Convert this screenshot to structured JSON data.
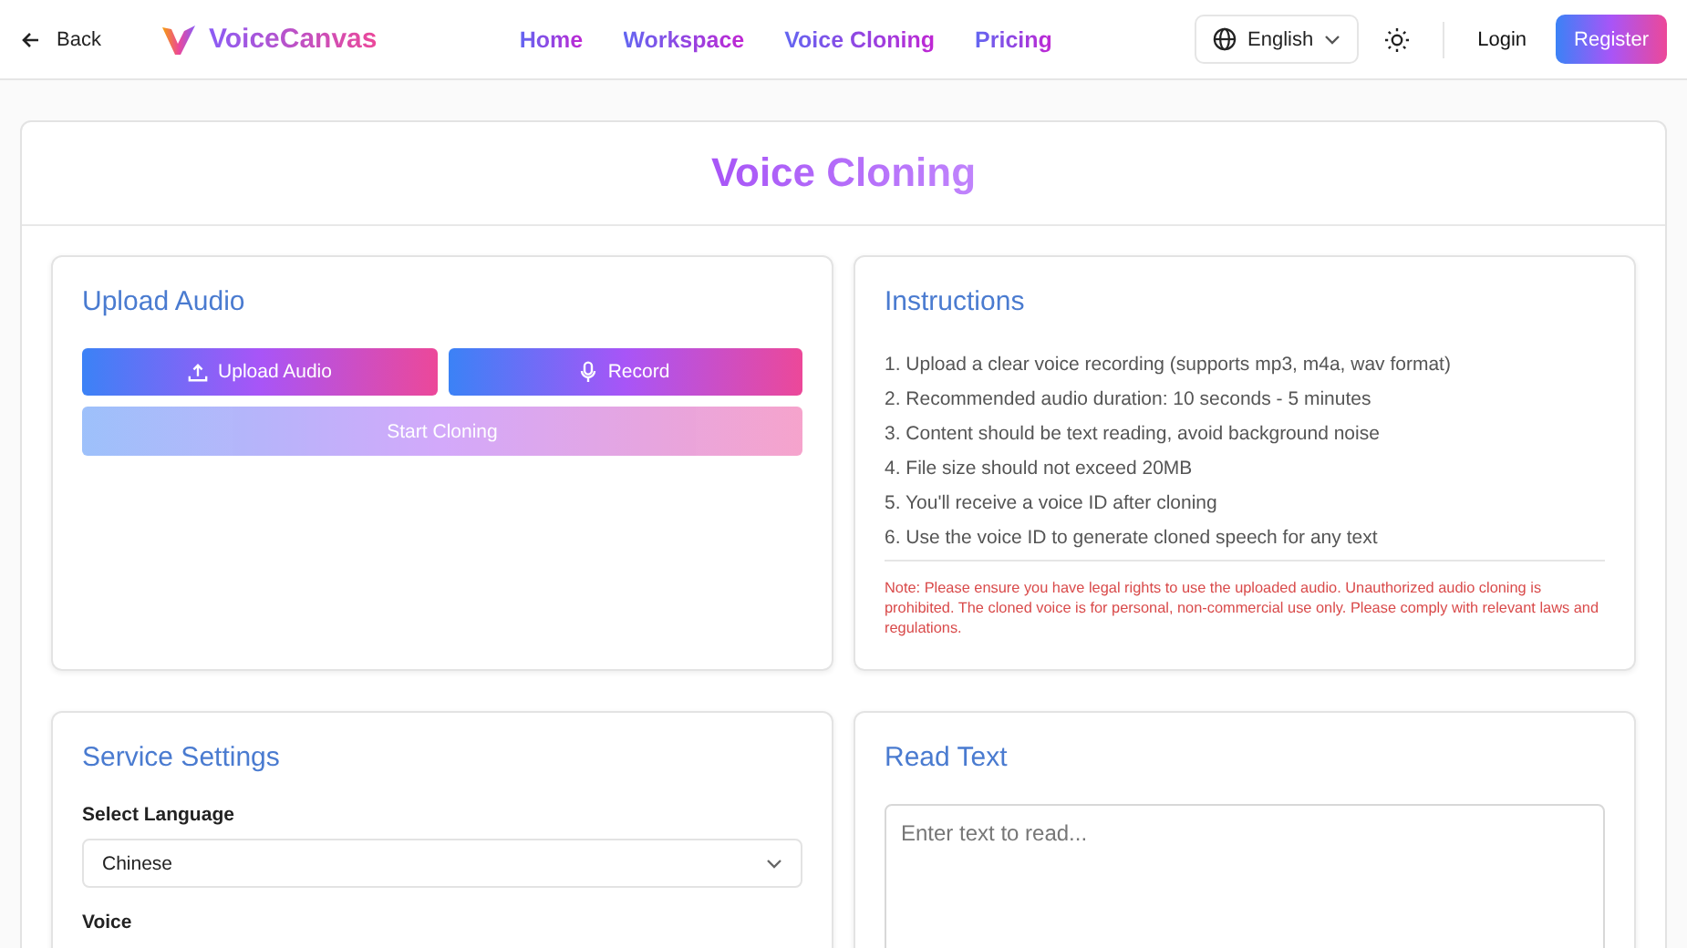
{
  "header": {
    "back": "Back",
    "brand": "VoiceCanvas",
    "nav": [
      "Home",
      "Workspace",
      "Voice Cloning",
      "Pricing"
    ],
    "language": "English",
    "login": "Login",
    "register": "Register"
  },
  "page_title": "Voice Cloning",
  "upload": {
    "title": "Upload Audio",
    "buttons": [
      {
        "kind": "upload",
        "label": "Upload Audio",
        "disabled": false
      },
      {
        "kind": "record",
        "label": "Record",
        "disabled": false
      }
    ],
    "start": {
      "label": "Start Cloning",
      "disabled": true
    }
  },
  "instructions": {
    "title": "Instructions",
    "items": [
      "1. Upload a clear voice recording (supports mp3, m4a, wav format)",
      "2. Recommended audio duration: 10 seconds - 5 minutes",
      "3. Content should be text reading, avoid background noise",
      "4. File size should not exceed 20MB",
      "5. You'll receive a voice ID after cloning",
      "6. Use the voice ID to generate cloned speech for any text"
    ],
    "note": "Note: Please ensure you have legal rights to use the uploaded audio. Unauthorized audio cloning is prohibited. The cloned voice is for personal, non-commercial use only. Please comply with relevant laws and regulations."
  },
  "settings": {
    "title": "Service Settings",
    "language_label": "Select Language",
    "language_value": "Chinese",
    "voice_label": "Voice"
  },
  "read_text": {
    "title": "Read Text",
    "placeholder": "Enter text to read..."
  }
}
